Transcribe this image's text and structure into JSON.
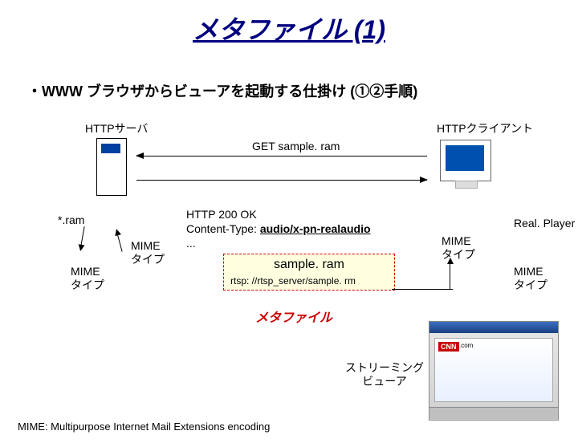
{
  "title": "メタファイル (1)",
  "subtitle": "・WWW ブラウザからビューアを起動する仕掛け (①②手順)",
  "server_label": "HTTPサーバ",
  "client_label": "HTTPクライアント",
  "get_request": "GET sample. ram",
  "ram_label": "*.ram",
  "mime_type_label": "MIME\nタイプ",
  "real_label": "Real. Player",
  "response": {
    "status": "HTTP 200 OK",
    "ct_prefix": "Content-Type: ",
    "ct_value": "audio/x-pn-realaudio",
    "ellipsis": "..."
  },
  "sample_box": {
    "title": "sample. ram",
    "rtsp": "rtsp: //rtsp_server/sample. rm"
  },
  "metafile_label": "メタファイル",
  "streaming_viewer": "ストリーミング\nビューア",
  "player": {
    "cnn": "CNN",
    "dotcom": ".com"
  },
  "footnote": "MIME: Multipurpose Internet Mail Extensions encoding"
}
